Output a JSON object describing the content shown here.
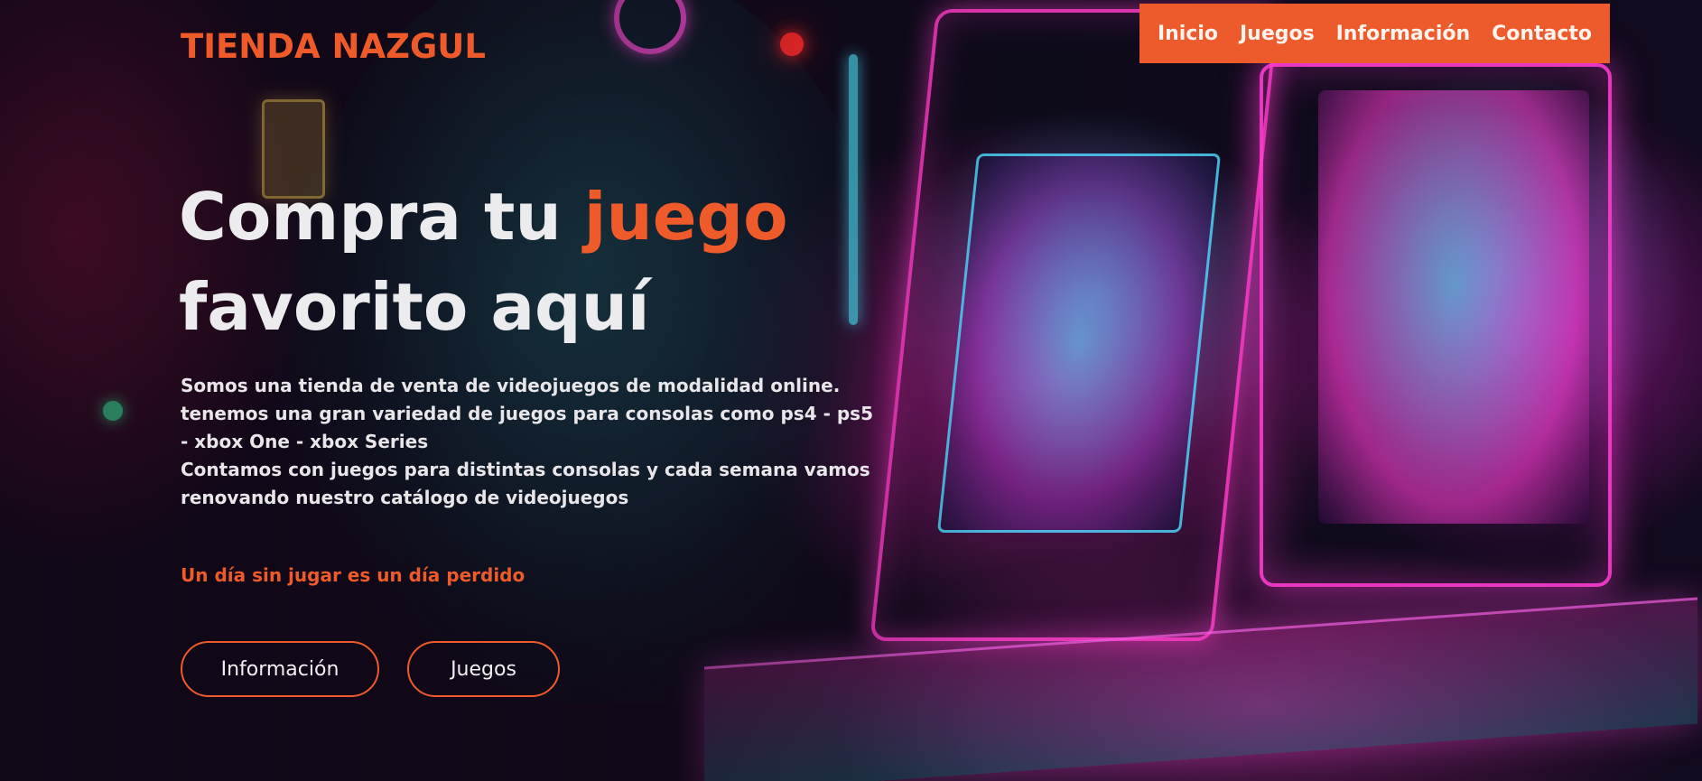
{
  "brand": "TIENDA NAZGUL",
  "nav": {
    "items": [
      "Inicio",
      "Juegos",
      "Información",
      "Contacto"
    ]
  },
  "hero": {
    "headline_part1": "Compra tu ",
    "headline_accent": "juego",
    "headline_part2": "favorito aquí",
    "intro_paragraph_1": "Somos una tienda de venta de videojuegos de modalidad online. tenemos una gran variedad de juegos para consolas como ps4 - ps5 - xbox One - xbox Series",
    "intro_paragraph_2": "Contamos con juegos para distintas consolas y cada semana vamos renovando nuestro catálogo de videojuegos",
    "tagline": "Un día sin jugar es un día perdido",
    "buttons": {
      "info_label": "Información",
      "games_label": "Juegos"
    }
  },
  "colors": {
    "accent": "#ef5a2b",
    "nav_background": "#ed5a2c",
    "text_light": "#ecebee"
  }
}
